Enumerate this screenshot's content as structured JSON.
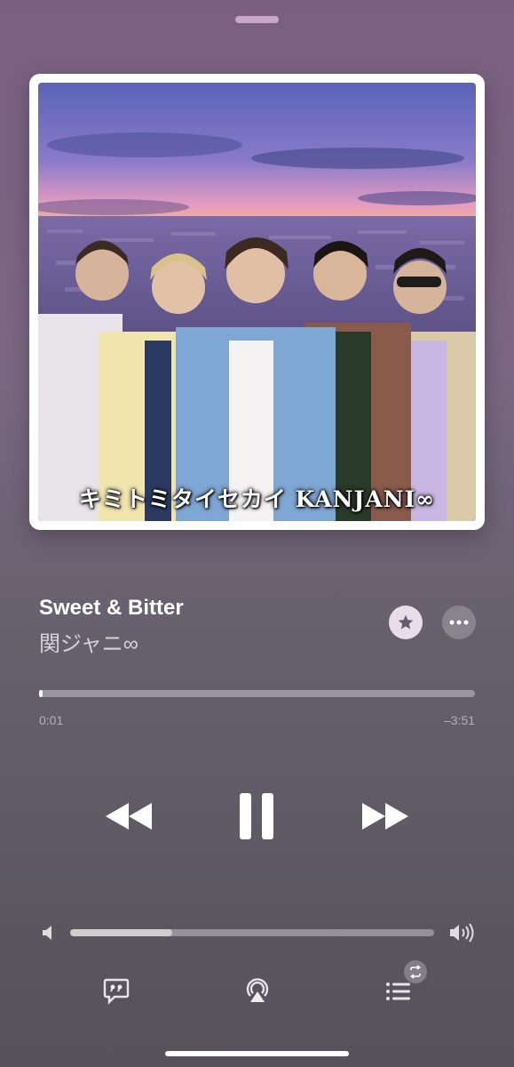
{
  "album": {
    "caption": "キミトミタイセカイ KANJANI∞"
  },
  "track": {
    "title": "Sweet & Bitter",
    "artist": "関ジャニ∞"
  },
  "progress": {
    "elapsed": "0:01",
    "remaining": "–3:51",
    "fraction": 0.004
  },
  "volume": {
    "fraction": 0.28
  },
  "icons": {
    "favorite": "star-icon",
    "more": "ellipsis-icon",
    "rewind": "rewind-icon",
    "pause": "pause-icon",
    "forward": "fast-forward-icon",
    "volume_low": "speaker-icon",
    "volume_high": "speaker-wave-icon",
    "lyrics": "lyrics-quote-icon",
    "airplay": "airplay-icon",
    "queue": "queue-list-icon",
    "repeat": "repeat-icon"
  },
  "colors": {
    "background_top": "#7a5f83",
    "background_bottom": "#55525a",
    "accent": "#ffffff"
  }
}
